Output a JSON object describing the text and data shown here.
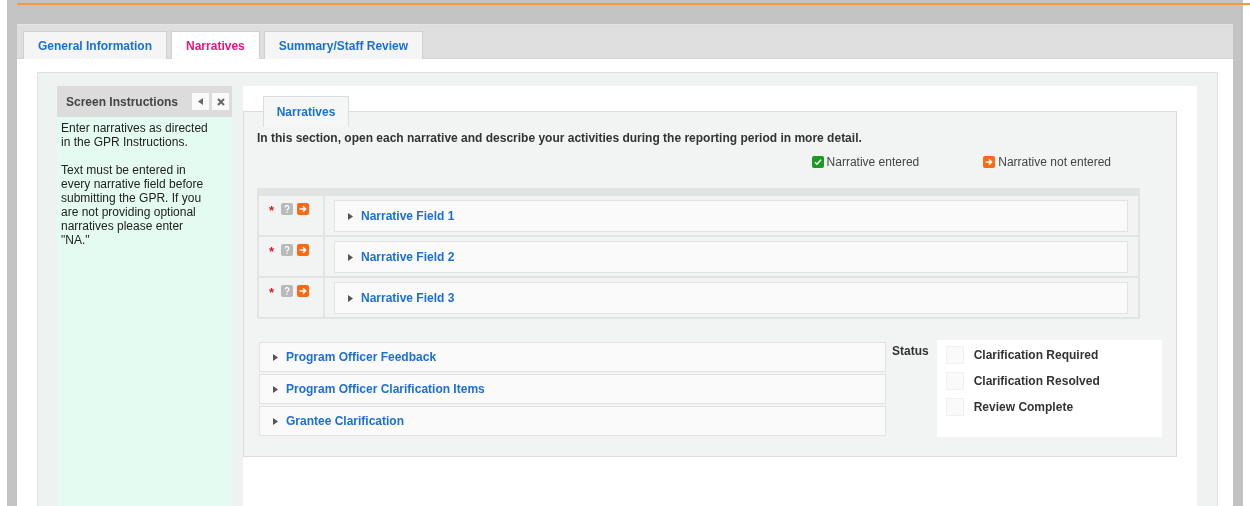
{
  "tabs": [
    {
      "label": "General Information",
      "selected": false
    },
    {
      "label": "Narratives",
      "selected": true
    },
    {
      "label": "Summary/Staff Review",
      "selected": false
    }
  ],
  "instructions": {
    "title": "Screen Instructions",
    "paragraphs": [
      "Enter narratives as directed in the GPR Instructions.",
      "Text must be entered in every narrative field before submitting the GPR. If you are not providing optional narratives please enter \"NA.\""
    ]
  },
  "section": {
    "tab": "Narratives",
    "intro": "In this section, open each narrative and describe your activities during the reporting period in more detail.",
    "legend": [
      {
        "kind": "entered",
        "label": "Narrative entered"
      },
      {
        "kind": "not_entered",
        "label": "Narrative not entered"
      }
    ],
    "narratives": [
      {
        "title": "Narrative Field 1",
        "required_mark": "*",
        "kind": "not_entered",
        "expanded": false
      },
      {
        "title": "Narrative Field 2",
        "required_mark": "*",
        "kind": "not_entered",
        "expanded": false
      },
      {
        "title": "Narrative Field 3",
        "required_mark": "*",
        "kind": "not_entered",
        "expanded": false
      }
    ]
  },
  "review": {
    "panels": [
      {
        "title": "Program Officer Feedback",
        "expanded": false
      },
      {
        "title": "Program Officer Clarification Items",
        "expanded": false
      },
      {
        "title": "Grantee Clarification",
        "expanded": false
      }
    ],
    "status_label": "Status",
    "statuses": [
      {
        "label": "Clarification Required",
        "checked": false
      },
      {
        "label": "Clarification Resolved",
        "checked": false
      },
      {
        "label": "Review Complete",
        "checked": false
      }
    ]
  }
}
